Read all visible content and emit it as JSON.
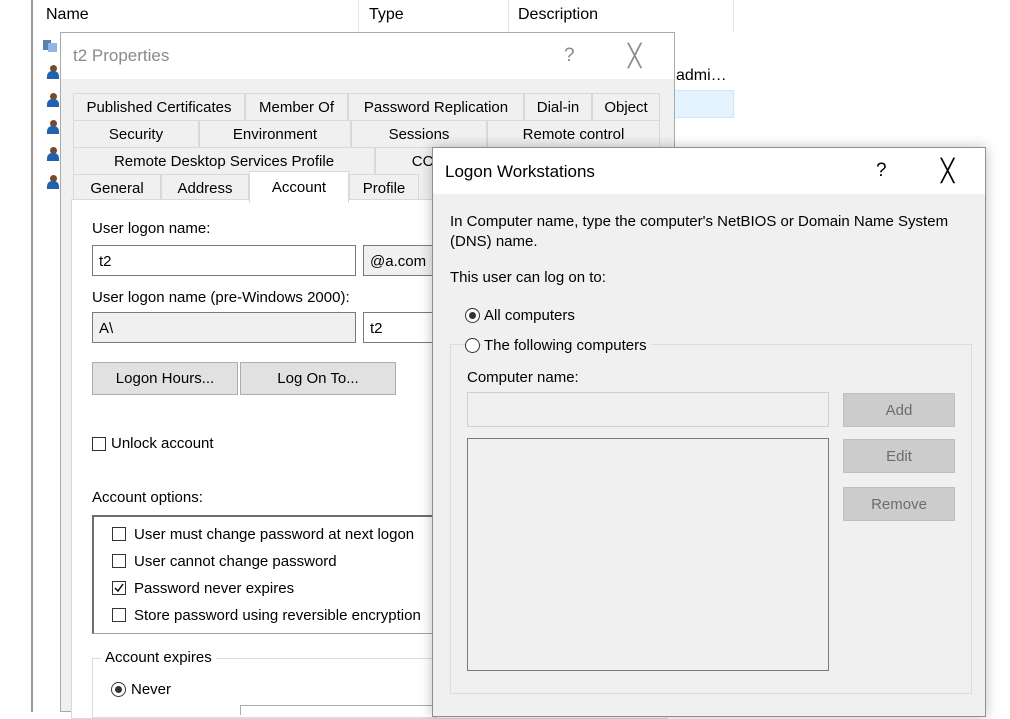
{
  "background": {
    "columns": [
      "Name",
      "Type",
      "Description"
    ],
    "row_fragment": "admi…"
  },
  "icons": {
    "group_icon": "group-icon",
    "user_icon": "user-icon",
    "radio_selected": "radio-selected",
    "checkbox_checked": "check-mark"
  },
  "properties": {
    "title": "t2 Properties",
    "help_label": "?",
    "close_label": "╳",
    "tabs_row1": [
      "Published Certificates",
      "Member Of",
      "Password Replication",
      "Dial-in",
      "Object"
    ],
    "tabs_row2": [
      "Security",
      "Environment",
      "Sessions",
      "Remote control"
    ],
    "tabs_row3": [
      "Remote Desktop Services Profile",
      "CO"
    ],
    "tabs_row4": [
      "General",
      "Address",
      "Account",
      "Profile"
    ],
    "active_tab": "Account",
    "account": {
      "logon_name_label": "User logon name:",
      "logon_name_value": "t2",
      "domain_suffix": "@a.com",
      "pre2000_label": "User logon name (pre-Windows 2000):",
      "pre2000_domain": "A\\",
      "pre2000_user": "t2",
      "logon_hours_button": "Logon Hours...",
      "log_on_to_button": "Log On To...",
      "unlock_label": "Unlock account",
      "unlock_checked": false,
      "options_label": "Account options:",
      "options": [
        {
          "label": "User must change password at next logon",
          "checked": false
        },
        {
          "label": "User cannot change password",
          "checked": false
        },
        {
          "label": "Password never expires",
          "checked": true
        },
        {
          "label": "Store password using reversible encryption",
          "checked": false
        }
      ],
      "expires_label": "Account expires",
      "never_label": "Never",
      "never_selected": true
    }
  },
  "logon_workstations": {
    "title": "Logon Workstations",
    "help_label": "?",
    "close_label": "╳",
    "instruction": "In Computer name, type the computer's NetBIOS or Domain Name System (DNS) name.",
    "can_log_on_label": "This user can log on to:",
    "all_computers_label": "All computers",
    "all_computers_selected": true,
    "following_label": "The following computers",
    "following_selected": false,
    "computer_name_label": "Computer name:",
    "computer_name_value": "",
    "add_button": "Add",
    "edit_button": "Edit",
    "remove_button": "Remove"
  }
}
